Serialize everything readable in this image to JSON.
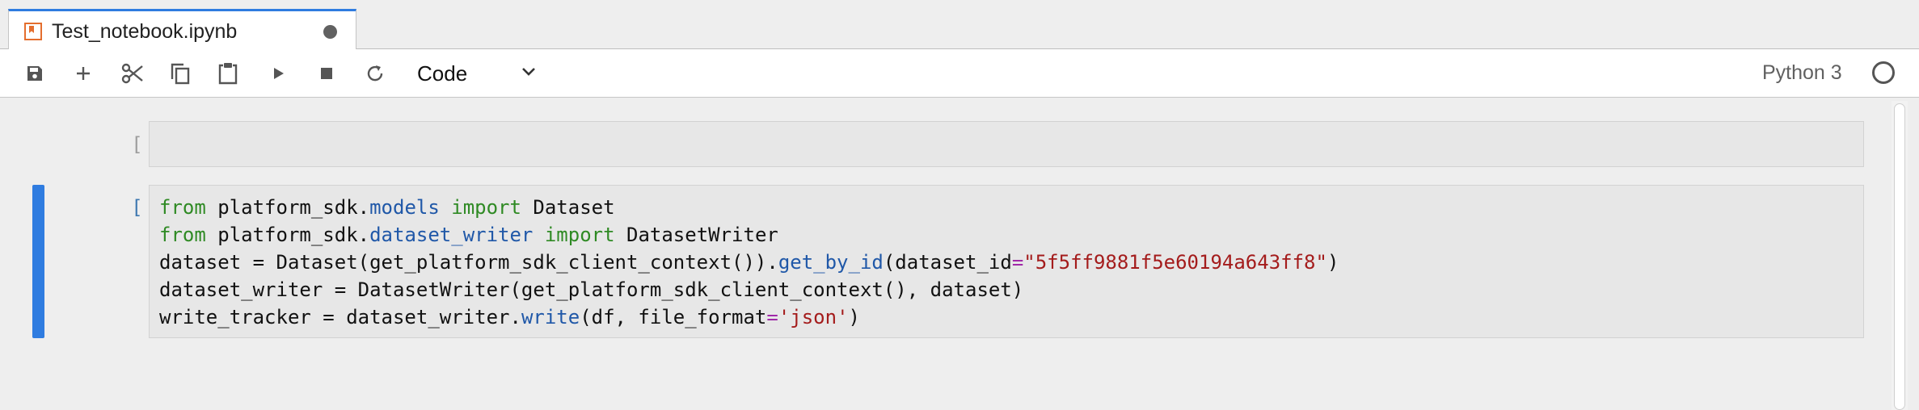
{
  "tab": {
    "title": "Test_notebook.ipynb",
    "icon": "notebook-icon",
    "dirty_indicator": "unsaved-dot-icon",
    "accent_color": "#2f7ce0",
    "icon_color": "#e46e2e"
  },
  "toolbar": {
    "buttons": [
      {
        "name": "save-button",
        "icon": "save-icon"
      },
      {
        "name": "insert-cell-button",
        "icon": "plus-icon"
      },
      {
        "name": "cut-button",
        "icon": "scissors-icon"
      },
      {
        "name": "copy-button",
        "icon": "copy-icon"
      },
      {
        "name": "paste-button",
        "icon": "clipboard-icon"
      },
      {
        "name": "run-button",
        "icon": "play-icon"
      },
      {
        "name": "interrupt-button",
        "icon": "stop-icon"
      },
      {
        "name": "restart-button",
        "icon": "refresh-icon"
      }
    ],
    "cell_type": "Code",
    "kernel_name": "Python 3",
    "kernel_status_icon": "kernel-idle-circle-icon"
  },
  "cells": [
    {
      "prompt": "[ ]:",
      "active": false,
      "code": []
    },
    {
      "prompt": "[ ]:",
      "active": true,
      "code": [
        "from platform_sdk.models import Dataset",
        "from platform_sdk.dataset_writer import DatasetWriter",
        "dataset = Dataset(get_platform_sdk_client_context()).get_by_id(dataset_id=\"5f5ff9881f5e60194a643ff8\")",
        "dataset_writer = DatasetWriter(get_platform_sdk_client_context(), dataset)",
        "write_tracker = dataset_writer.write(df, file_format='json')"
      ]
    }
  ],
  "colors": {
    "keyword": "#2f8a24",
    "module": "#2058a8",
    "string": "#a41c1c",
    "operator": "#a029a8",
    "active_prompt": "#3f78b0"
  }
}
